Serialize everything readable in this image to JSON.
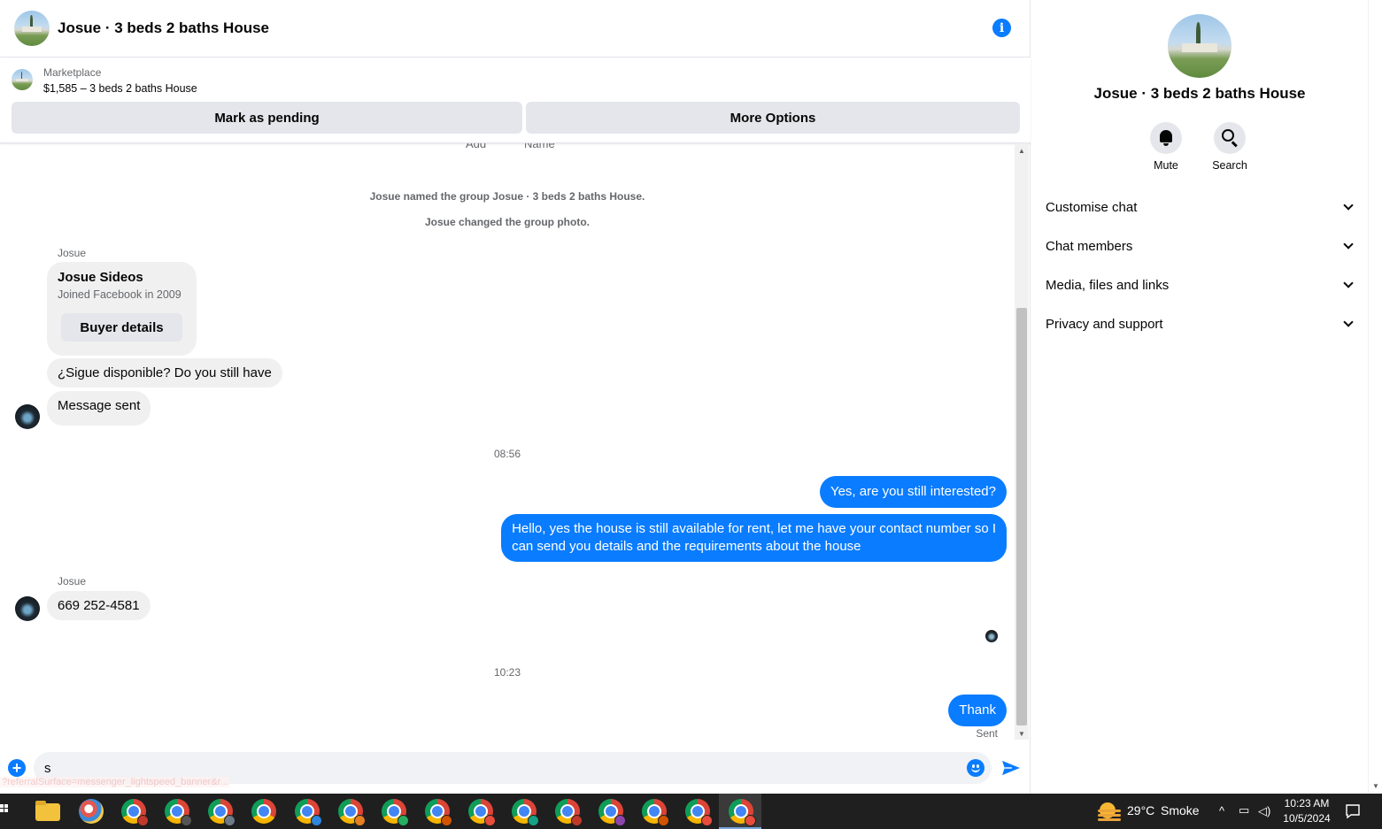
{
  "header": {
    "title": "Josue · 3 beds 2 baths House",
    "info_icon": "info-icon",
    "info_glyph": "i"
  },
  "marketplace": {
    "label": "Marketplace",
    "listing_title": "$1,585 – 3 beds 2 baths House",
    "pending_button": "Mark as pending",
    "options_button": "More Options"
  },
  "messages": {
    "cut_add": "Add",
    "cut_name": "Name",
    "system_rename": "Josue named the group Josue · 3 beds 2 baths House.",
    "system_photo": "Josue changed the group photo.",
    "sender_1": "Josue",
    "profile_name": "Josue Sideos",
    "profile_joined": "Joined Facebook in 2009",
    "buyer_details": "Buyer details",
    "incoming_1": "¿Sigue disponible? Do you still have",
    "incoming_2": "Message sent",
    "time_1": "08:56",
    "outgoing_1": "Yes, are you still interested?",
    "outgoing_2_line1": "Hello, yes the house is still available for rent, let me have your contact number so I",
    "outgoing_2_line2": "can send you details and the requirements about the house",
    "sender_2": "Josue",
    "incoming_3": "669 252-4581",
    "time_2": "10:23",
    "outgoing_3": "Thank",
    "sent_status": "Sent"
  },
  "composer": {
    "value": "s",
    "status_url": "?referralSurface=messenger_lightspeed_banner&r..."
  },
  "right_panel": {
    "title": "Josue · 3 beds 2 baths House",
    "mute_label": "Mute",
    "search_label": "Search",
    "sections": [
      "Customise chat",
      "Chat members",
      "Media, files and links",
      "Privacy and support"
    ]
  },
  "taskbar": {
    "temperature": "29°C",
    "weather": "Smoke",
    "time": "10:23 AM",
    "date": "10/5/2024"
  },
  "colors": {
    "accent": "#0a7cff",
    "bubble_in": "#f0f0f0",
    "button_bg": "#e4e6eb",
    "taskbar": "#1f1f1f"
  }
}
